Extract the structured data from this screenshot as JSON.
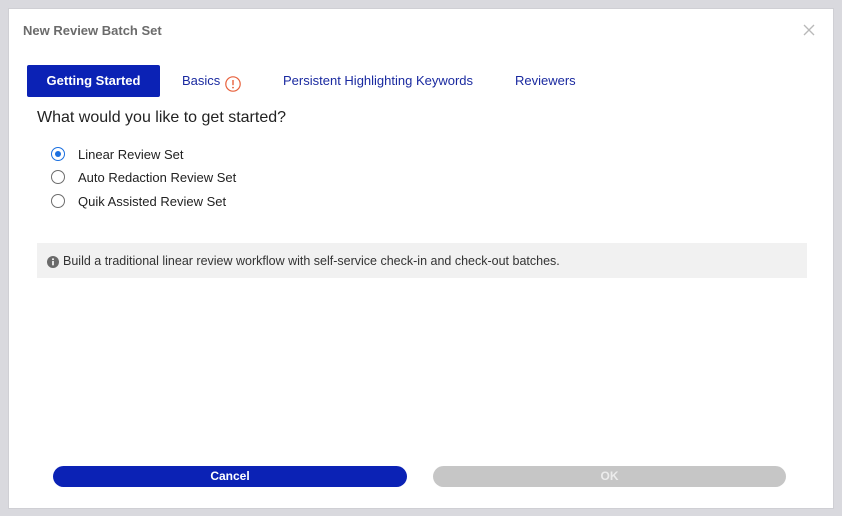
{
  "dialog": {
    "title": "New Review Batch Set",
    "close_icon": "close-icon"
  },
  "tabs": [
    {
      "label": "Getting Started",
      "active": true
    },
    {
      "label": "Basics",
      "active": false,
      "icon": "warning-icon"
    },
    {
      "label": "Persistent Highlighting Keywords",
      "active": false
    },
    {
      "label": "Reviewers",
      "active": false
    }
  ],
  "question": "What would you like to get started?",
  "options": [
    {
      "label": "Linear Review Set",
      "checked": true
    },
    {
      "label": "Auto Redaction Review Set",
      "checked": false
    },
    {
      "label": "Quik Assisted Review Set",
      "checked": false
    }
  ],
  "info": {
    "icon": "info-icon",
    "text": "Build a traditional linear review workflow with self-service check-in and check-out batches."
  },
  "buttons": {
    "cancel_label": "Cancel",
    "ok_label": "OK"
  },
  "colors": {
    "primary": "#0b22b5",
    "link": "#1a2aa0",
    "radio_checked": "#1a6fe0",
    "warning": "#e8613c",
    "disabled": "#c6c6c6"
  }
}
